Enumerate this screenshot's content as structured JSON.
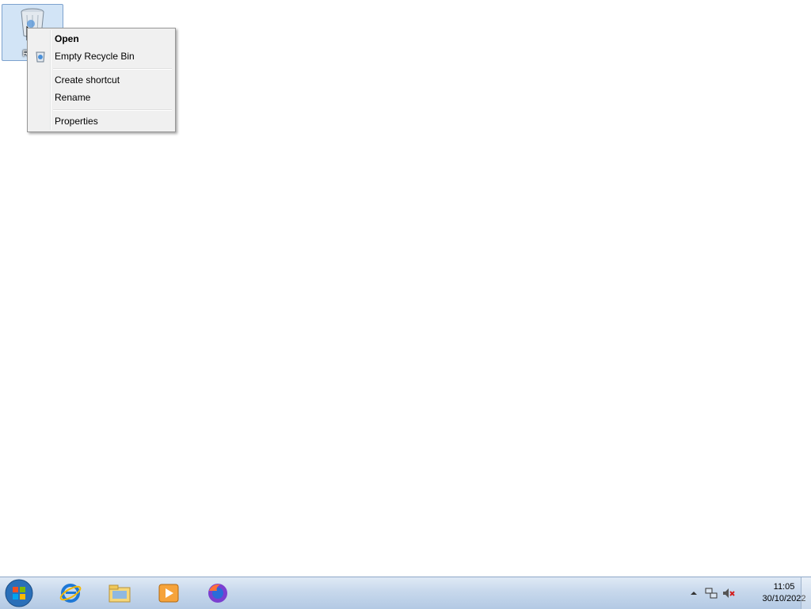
{
  "desktop": {
    "icons": [
      {
        "label": "Recy",
        "icon": "recycle-bin-icon"
      }
    ]
  },
  "context_menu": {
    "items": [
      {
        "label": "Open",
        "bold": true
      },
      {
        "label": "Empty Recycle Bin",
        "icon": "recycle-bin-icon"
      },
      {
        "label": "Create shortcut"
      },
      {
        "label": "Rename"
      },
      {
        "label": "Properties"
      }
    ]
  },
  "taskbar": {
    "start_icon": "windows-start-icon",
    "pinned": [
      {
        "icon": "internet-explorer-icon"
      },
      {
        "icon": "file-explorer-icon"
      },
      {
        "icon": "media-player-icon"
      },
      {
        "icon": "firefox-icon"
      }
    ],
    "tray": {
      "icons": [
        "show-hidden-icons",
        "network-icon",
        "volume-muted-icon"
      ],
      "time": "11:05",
      "date": "30/10/2022"
    }
  },
  "colors": {
    "menu_bg": "#f0f0f0",
    "taskbar": "#c7d8ec"
  }
}
